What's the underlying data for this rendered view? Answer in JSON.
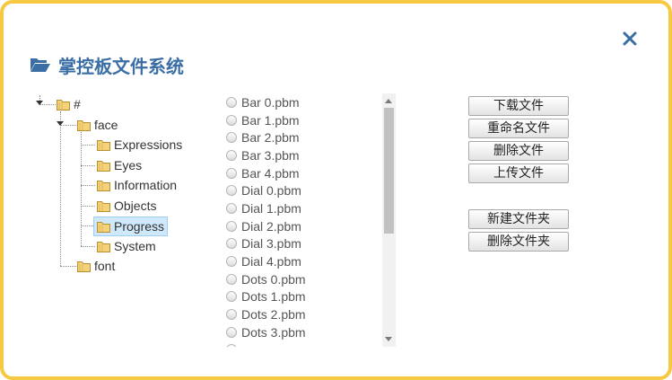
{
  "dialog": {
    "title": "掌控板文件系统",
    "close_icon": "close-icon",
    "folder_icon": "folder-open-icon",
    "accent_color": "#3a6ea5",
    "border_color": "#f7c842"
  },
  "tree": {
    "root": "#",
    "face": "face",
    "children": [
      "Expressions",
      "Eyes",
      "Information",
      "Objects",
      "Progress",
      "System"
    ],
    "selected": "Progress",
    "font": "font"
  },
  "files": [
    "Bar 0.pbm",
    "Bar 1.pbm",
    "Bar 2.pbm",
    "Bar 3.pbm",
    "Bar 4.pbm",
    "Dial 0.pbm",
    "Dial 1.pbm",
    "Dial 2.pbm",
    "Dial 3.pbm",
    "Dial 4.pbm",
    "Dots 0.pbm",
    "Dots 1.pbm",
    "Dots 2.pbm",
    "Dots 3.pbm"
  ],
  "buttons": {
    "download": "下载文件",
    "rename": "重命名文件",
    "delete_file": "删除文件",
    "upload": "上传文件",
    "new_folder": "新建文件夹",
    "delete_folder": "删除文件夹"
  }
}
